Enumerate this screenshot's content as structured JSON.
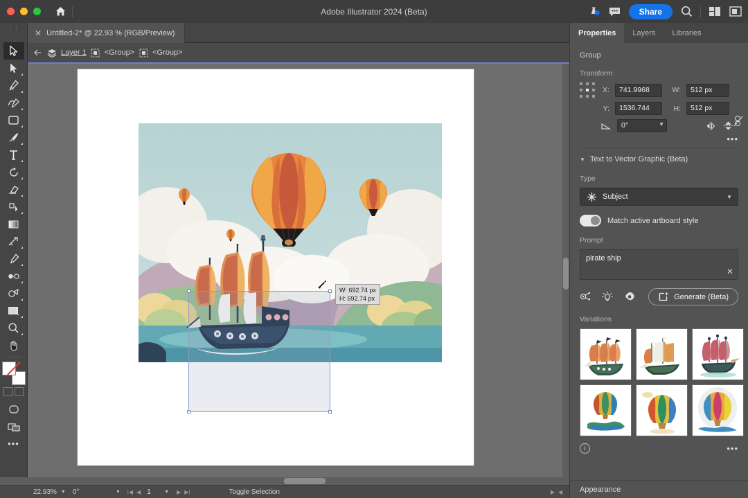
{
  "titlebar": {
    "app_title": "Adobe Illustrator 2024 (Beta)",
    "home_icon": "home-icon",
    "cloud_icon": "cloud-sync-icon",
    "comment_icon": "comment-icon",
    "share_label": "Share",
    "search_icon": "search-icon",
    "workspace_icon": "workspace-switcher-icon",
    "panel_icon": "panel-layout-icon"
  },
  "document_tab": {
    "close_icon": "close-icon",
    "label": "Untitled-2* @ 22.93 % (RGB/Preview)"
  },
  "breadcrumb": {
    "back_icon": "back-arrow-icon",
    "items": [
      {
        "icon": "layers-icon",
        "label": "Layer 1"
      },
      {
        "icon": "group-icon",
        "label": "<Group>"
      },
      {
        "icon": "group-icon",
        "label": "<Group>"
      }
    ]
  },
  "toolbar": {
    "grip": "▮▮",
    "tools": [
      {
        "name": "selection-tool",
        "glyph": "selection",
        "active": true,
        "corner": false
      },
      {
        "name": "direct-selection-tool",
        "glyph": "direct-selection",
        "active": false,
        "corner": true
      },
      {
        "name": "pen-tool",
        "glyph": "pen",
        "active": false,
        "corner": true
      },
      {
        "name": "curvature-tool",
        "glyph": "curvature",
        "active": false,
        "corner": true
      },
      {
        "name": "rectangle-tool",
        "glyph": "rectangle",
        "active": false,
        "corner": true
      },
      {
        "name": "paintbrush-tool",
        "glyph": "brush",
        "active": false,
        "corner": true
      },
      {
        "name": "type-tool",
        "glyph": "type",
        "active": false,
        "corner": true
      },
      {
        "name": "rotate-tool",
        "glyph": "rotate",
        "active": false,
        "corner": true
      },
      {
        "name": "eraser-tool",
        "glyph": "eraser",
        "active": false,
        "corner": true
      },
      {
        "name": "scale-tool",
        "glyph": "scale",
        "active": false,
        "corner": true
      },
      {
        "name": "gradient-tool",
        "glyph": "gradient",
        "active": false,
        "corner": false
      },
      {
        "name": "width-tool",
        "glyph": "width",
        "active": false,
        "corner": true
      },
      {
        "name": "eyedropper-tool",
        "glyph": "eyedropper",
        "active": false,
        "corner": true
      },
      {
        "name": "blend-tool",
        "glyph": "blend",
        "active": false,
        "corner": true
      },
      {
        "name": "shape-builder-tool",
        "glyph": "shapebuilder",
        "active": false,
        "corner": true
      },
      {
        "name": "artboard-tool",
        "glyph": "artboard",
        "active": false,
        "corner": true
      },
      {
        "name": "zoom-tool",
        "glyph": "zoom",
        "active": false,
        "corner": true
      },
      {
        "name": "hand-tool",
        "glyph": "hand",
        "active": false,
        "corner": false
      }
    ],
    "fill_color": "#ffffff",
    "stroke_color": "#ffffff",
    "more_tools_label": "•••"
  },
  "canvas": {
    "zoom_cursor_icon": "resize-diagonal-cursor",
    "tooltip_w": "W: 692.74 px",
    "tooltip_h": "H: 692.74 px",
    "artwork_description": "hot-air-balloon-and-pirate-ship-landscape"
  },
  "statusbar": {
    "zoom_value": "22.93%",
    "rotate_value": "0°",
    "artboard_value": "1",
    "selection_label": "Toggle Selection",
    "nav_first": "|◀",
    "nav_prev": "◀",
    "nav_next": "▶",
    "nav_last": "▶|",
    "right_next": "▶",
    "right_prev": "◀"
  },
  "properties": {
    "tabs": [
      {
        "label": "Properties",
        "active": true
      },
      {
        "label": "Layers",
        "active": false
      },
      {
        "label": "Libraries",
        "active": false
      }
    ],
    "selection_label": "Group",
    "transform": {
      "heading": "Transform",
      "reference_point_icon": "reference-point-grid",
      "x_label": "X:",
      "x_value": "741.9968",
      "y_label": "Y:",
      "y_value": "1536.744",
      "w_label": "W:",
      "w_value": "512 px",
      "h_label": "H:",
      "h_value": "512 px",
      "angle_label": "angle-icon",
      "angle_value": "0°",
      "link_icon": "unlink-proportions-icon",
      "flip_h_icon": "flip-horizontal-icon",
      "flip_v_icon": "flip-vertical-icon",
      "more_icon": "more-options-icon"
    },
    "text_to_vector": {
      "heading": "Text to Vector Graphic (Beta)",
      "chevron": "chevron-down-icon",
      "type_label": "Type",
      "type_icon": "subject-icon",
      "type_value": "Subject",
      "match_toggle_label": "Match active artboard style",
      "match_toggle_on": true,
      "prompt_label": "Prompt",
      "prompt_value": "pirate ship",
      "prompt_clear_icon": "clear-icon",
      "action_icons": [
        "prompt-suggestion-icon",
        "inspiration-icon",
        "settings-gear-icon"
      ],
      "generate_label": "Generate (Beta)",
      "generate_icon": "generate-sparkle-icon",
      "variations_label": "Variations",
      "variations": [
        {
          "name": "variation-1",
          "kind": "ship",
          "palette": [
            "#c96a3e",
            "#2f5b4a",
            "#e3a05a"
          ]
        },
        {
          "name": "variation-2",
          "kind": "ship",
          "palette": [
            "#d98a4e",
            "#4a6b4e",
            "#f0c98a"
          ]
        },
        {
          "name": "variation-3",
          "kind": "ship",
          "palette": [
            "#c4606c",
            "#3b5c4f",
            "#8ecfc2"
          ]
        },
        {
          "name": "variation-4",
          "kind": "balloon",
          "palette": [
            "#d4b33c",
            "#3f8f63",
            "#2f7fb5"
          ]
        },
        {
          "name": "variation-5",
          "kind": "balloon",
          "palette": [
            "#e0c040",
            "#2f8f5f",
            "#d4562f"
          ]
        },
        {
          "name": "variation-6",
          "kind": "balloon",
          "palette": [
            "#e8a63a",
            "#c93f6b",
            "#3f8fc4"
          ]
        }
      ],
      "info_icon": "info-icon",
      "more_icon": "more-options-icon"
    },
    "appearance_heading": "Appearance"
  },
  "colors": {
    "accent": "#1473e6",
    "panel_bg": "#535353",
    "chrome_bg": "#454545",
    "canvas_bg": "#6e6e6e",
    "breadcrumb_underline": "#6e7fc4"
  }
}
